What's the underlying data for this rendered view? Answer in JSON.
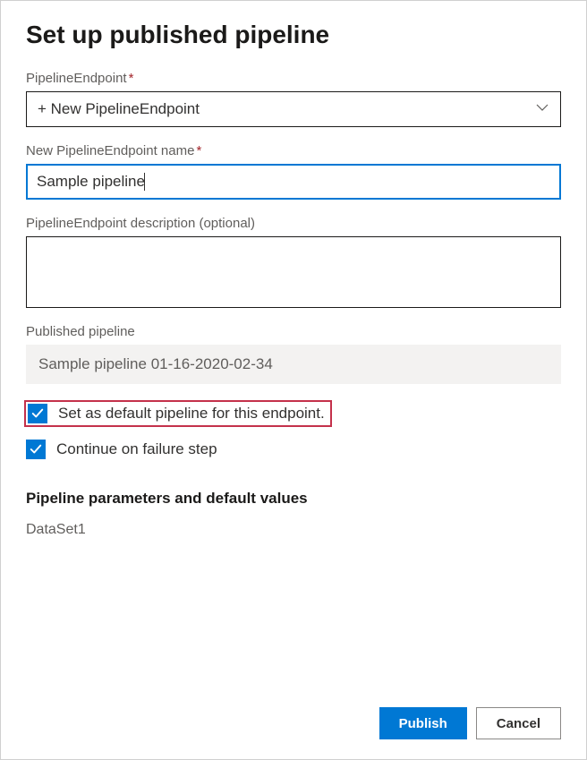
{
  "dialog": {
    "title": "Set up published pipeline"
  },
  "fields": {
    "endpoint": {
      "label": "PipelineEndpoint",
      "value": "+ New PipelineEndpoint"
    },
    "name": {
      "label": "New PipelineEndpoint name",
      "value": "Sample pipeline"
    },
    "description": {
      "label": "PipelineEndpoint description (optional)",
      "value": ""
    },
    "published": {
      "label": "Published pipeline",
      "value": "Sample pipeline 01-16-2020-02-34"
    }
  },
  "checkboxes": {
    "default": "Set as default pipeline for this endpoint.",
    "continue": "Continue on failure step"
  },
  "parameters": {
    "heading": "Pipeline parameters and default values",
    "items": [
      "DataSet1"
    ]
  },
  "buttons": {
    "publish": "Publish",
    "cancel": "Cancel"
  }
}
